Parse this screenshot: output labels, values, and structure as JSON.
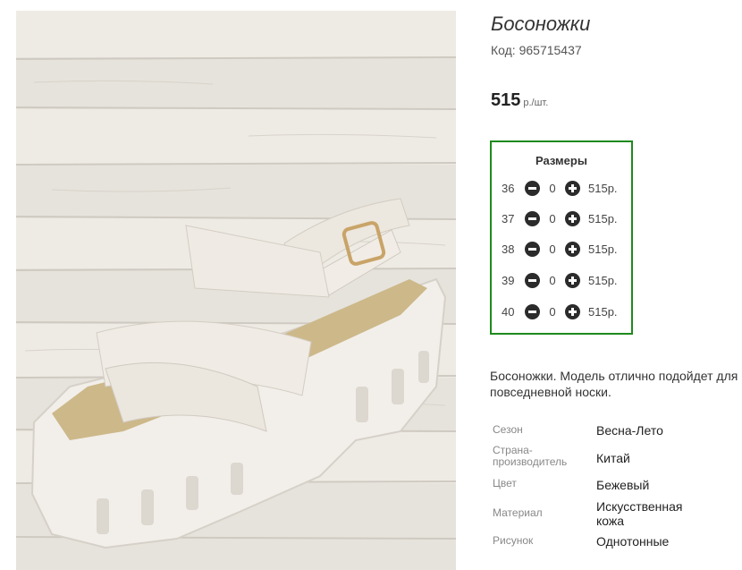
{
  "product": {
    "title": "Босоножки",
    "code": "Код: 965715437",
    "image_alt": "sandal-photo"
  },
  "price": {
    "amount": "515",
    "unit": "р./шт."
  },
  "sizes": {
    "title": "Размеры",
    "rows": [
      {
        "size": "36",
        "qty": "0",
        "price": "515р."
      },
      {
        "size": "37",
        "qty": "0",
        "price": "515р."
      },
      {
        "size": "38",
        "qty": "0",
        "price": "515р."
      },
      {
        "size": "39",
        "qty": "0",
        "price": "515р."
      },
      {
        "size": "40",
        "qty": "0",
        "price": "515р."
      }
    ]
  },
  "description": "Босоножки. Модель отлично подойдет для повседневной носки.",
  "attributes": [
    {
      "key": "Сезон",
      "value": "Весна-Лето"
    },
    {
      "key": "Страна-производитель",
      "value": "Китай"
    },
    {
      "key": "Цвет",
      "value": "Бежевый"
    },
    {
      "key": "Материал",
      "value": "Искусственная кожа"
    },
    {
      "key": "Рисунок",
      "value": "Однотонные"
    }
  ],
  "colors": {
    "border_green": "#1e8a1e",
    "button_dark": "#2b2b2b"
  }
}
